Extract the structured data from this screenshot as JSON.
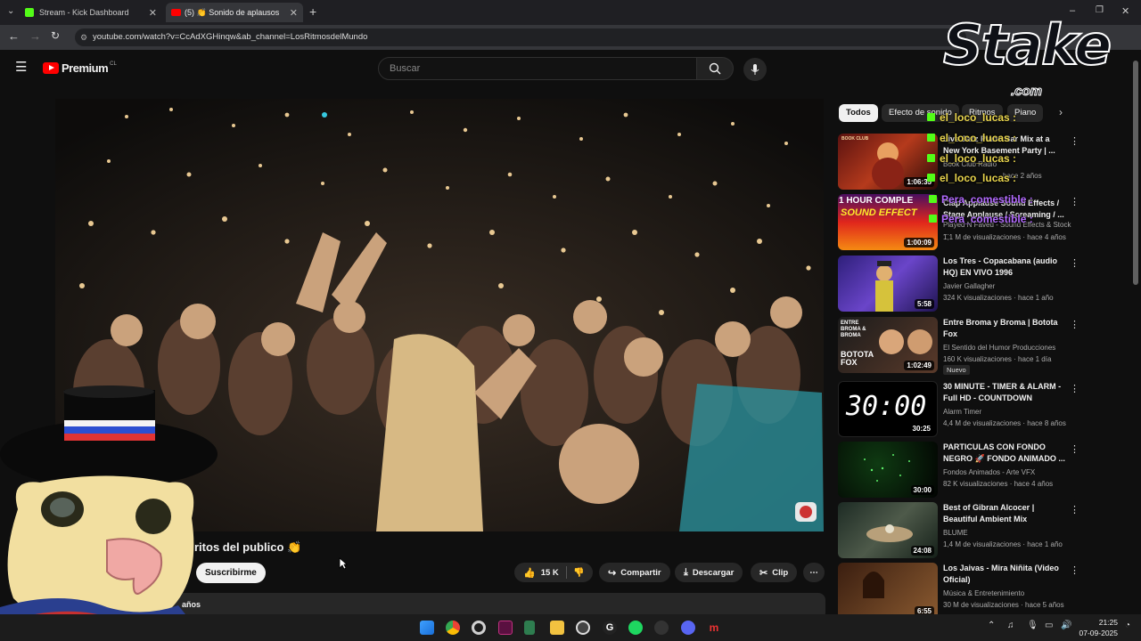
{
  "browser": {
    "tabs": [
      {
        "label": "Stream - Kick Dashboard"
      },
      {
        "label": "(5) 👏 Sonido de aplausos"
      }
    ],
    "url": "youtube.com/watch?v=CcAdXGHinqw&ab_channel=LosRitmosdelMundo"
  },
  "header": {
    "logo": "Premium",
    "region": "CL",
    "search_placeholder": "Buscar"
  },
  "video": {
    "title_visible": "ritos del publico 👏",
    "subscribe_label": "Suscribirme",
    "likes": "15 K",
    "share_label": "Compartir",
    "download_label": "Descargar",
    "clip_label": "Clip",
    "desc_snippet": "años"
  },
  "chips": [
    "Todos",
    "Efecto de sonido",
    "Ritmos",
    "Piano"
  ],
  "recommendations": [
    {
      "title": "Live Jazz Piano Bar Mix at a New York Basement Party | ...",
      "channel": "Book Club Radio",
      "meta": "hace 2 años",
      "duration": "1:06:35"
    },
    {
      "title": "Clap Applause Sound Effects / Stage Applause / Screaming / ...",
      "channel": "Played N Faved - Sound Effects & Stock ...",
      "meta": "1,1 M de visualizaciones · hace 4 años",
      "duration": "1:00:09"
    },
    {
      "title": "Los Tres - Copacabana (audio HQ) EN VIVO 1996",
      "channel": "Javier Gallagher",
      "meta": "324 K visualizaciones · hace 1 año",
      "duration": "5:58"
    },
    {
      "title": "Entre Broma y Broma | Botota Fox",
      "channel": "El Sentido del Humor Producciones",
      "meta": "160 K visualizaciones · hace 1 día",
      "badge": "Nuevo",
      "duration": "1:02:49"
    },
    {
      "title": "30 MINUTE - TIMER & ALARM - Full HD - COUNTDOWN",
      "channel": "Alarm Timer",
      "meta": "4,4 M de visualizaciones · hace 8 años",
      "duration": "30:25"
    },
    {
      "title": "PARTICULAS CON FONDO NEGRO 🚀 FONDO ANIMADO ...",
      "channel": "Fondos Animados - Arte VFX",
      "meta": "82 K visualizaciones · hace 4 años",
      "duration": "30:00"
    },
    {
      "title": "Best of Gibran Alcocer | Beautiful Ambient Mix",
      "channel": "BLUME",
      "meta": "1,4 M de visualizaciones · hace 1 año",
      "duration": "24:08"
    },
    {
      "title": "Los Jaivas - Mira Niñita (Video Oficial)",
      "channel": "Música & Entretenimiento",
      "meta": "30 M de visualizaciones · hace 5 años",
      "duration": "6:55"
    }
  ],
  "thumb_text": {
    "book_club": "BOOK CLUB",
    "one_hour": "1 HOUR COMPLE",
    "sound_effect": "SOUND EFFECT",
    "entre": "ENTRE BROMA & BROMA",
    "botota": "BOTOTA FOX",
    "timer": "30:00"
  },
  "overlay": {
    "brand": "Stake",
    "brand_domain": ".com",
    "chat": [
      {
        "user": "el_loco_lucas :",
        "color": "#e8d44d"
      },
      {
        "user": "el_loco_lucas :",
        "color": "#e8d44d"
      },
      {
        "user": "el_loco_lucas :",
        "color": "#e8d44d"
      },
      {
        "user": "el_loco_lucas :",
        "color": "#e8d44d"
      },
      {
        "user": "Pera_comestible :",
        "color": "#b36bff"
      },
      {
        "user": "Pera_comestible :",
        "color": "#b36bff"
      }
    ]
  },
  "taskbar": {
    "time": "21:25",
    "date": "07-09-2025"
  }
}
